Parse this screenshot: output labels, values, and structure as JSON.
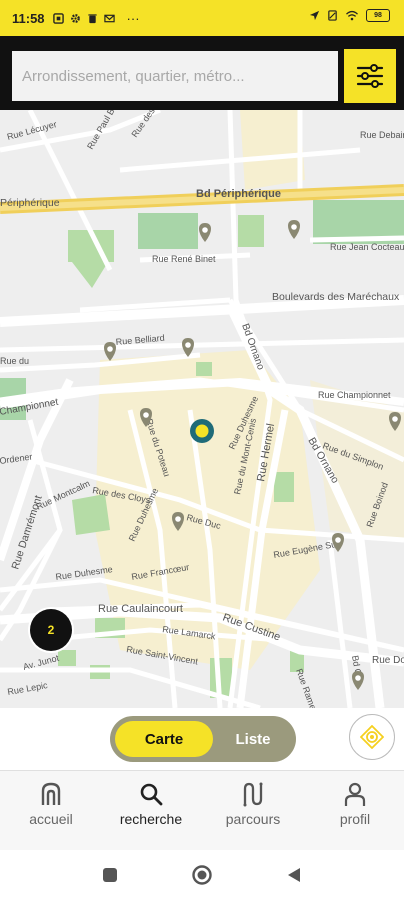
{
  "status_bar": {
    "time": "11:58",
    "left_icons": [
      "sim-icon",
      "gear-icon",
      "trash-icon",
      "mail-icon",
      "more-dots-icon"
    ],
    "more": "···",
    "right_icons": [
      "location-icon",
      "no-sim-icon",
      "wifi-icon",
      "battery-icon"
    ],
    "battery": "98"
  },
  "search": {
    "placeholder": "Arrondissement, quartier, métro...",
    "filter_icon": "sliders-icon"
  },
  "map": {
    "streets": {
      "peripherique_left": "Périphérique",
      "peripherique_right": "Bd Périphérique",
      "rene_binet": "Rue René Binet",
      "jean_cocteau": "Rue Jean Cocteau",
      "marechaux": "Boulevards des Maréchaux",
      "ornano_top": "Bd Ornano",
      "ornano_right": "Bd Ornano",
      "belliard": "Rue Belliard",
      "championnet_left": "Championnet",
      "championnet_right": "Rue Championnet",
      "poteau": "Rue du Poteau",
      "duhesme_top": "Rue Duhesme",
      "mont_cenis": "Rue du Mont-Cenis",
      "hermel": "Rue Hermel",
      "simplon": "Rue du Simplon",
      "damremont": "Rue Damrémont",
      "montcalm": "Rue Montcalm",
      "cloys": "Rue des Cloys",
      "duhesme_mid": "Rue Duhesme",
      "duc": "Rue Duc",
      "boinod": "Rue Boinod",
      "eugene_sue": "Rue Eugène Sue",
      "duhesme_low": "Rue Duhesme",
      "francoeur": "Rue Francœur",
      "caulaincourt": "Rue Caulaincourt",
      "custine": "Rue Custine",
      "lamarck": "Rue Lamarck",
      "saint_vincent": "Rue Saint-Vincent",
      "junot": "Av. Junot",
      "lepic": "Rue Lepic",
      "ramey": "Rue Ramey",
      "doudeauville": "Rue Doudeauville",
      "debain": "Rue Debain",
      "lecuyer": "Rue Lécuyer",
      "paul_bert": "Rue Paul Bert",
      "rosiers": "Rue des Rosiers",
      "ordener": "Ordener",
      "du": "Rue du",
      "ornano_bottom": "Bd Or"
    },
    "cluster_count": "2",
    "pin_count": 11
  },
  "view_toggle": {
    "map_label": "Carte",
    "list_label": "Liste",
    "active": "Carte"
  },
  "locate_button": {
    "icon": "locate-icon"
  },
  "bottom_nav": {
    "items": [
      {
        "label": "accueil",
        "icon": "home-icon"
      },
      {
        "label": "recherche",
        "icon": "search-icon"
      },
      {
        "label": "parcours",
        "icon": "route-icon"
      },
      {
        "label": "profil",
        "icon": "user-icon"
      }
    ],
    "active": "recherche"
  },
  "colors": {
    "accent": "#f5e227",
    "header_bg": "#111111",
    "toggle_bg": "#9b9a7d",
    "pin": "#8a8872",
    "current_marker": "#1f6b78"
  }
}
